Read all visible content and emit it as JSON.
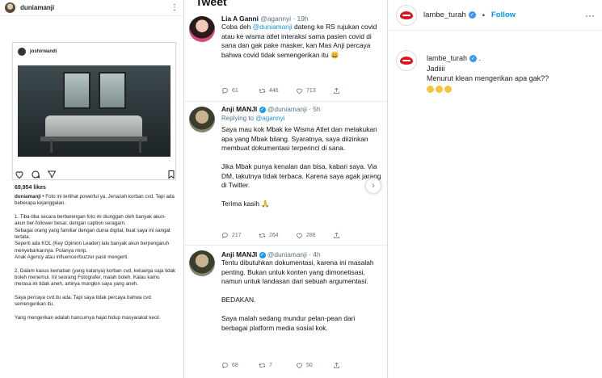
{
  "left": {
    "username": "duniamanji",
    "embedded_username": "joshirwandi",
    "likes": "69,954 likes",
    "caption_user": "duniamanji",
    "caption_paragraphs": [
      "• Foto ini terlihat powerful ya. Jenazah korban cvd. Tapi ada beberapa kejanggalan.",
      "1. Tiba-tiba secara berbarengan foto ini diunggah oleh banyak akun-akun ber-follower besar, dengan caption seragam.\nSebagai orang yang familiar dengan dunia digital, buat saya ini sangat tertata.\nSeperti ada KOL (Key Opinion Leader) lalu banyak akun berpengaruh menyebarkannya. Polanya mirip.\nAnak Agency atau influencer/buzzer pasti mengerti.",
      "2. Dalam kasus kematian (yang katanya) korban cvd, keluarga saja tidak boleh menemui. Ini seorang Fotografer, malah boleh. Kalau kamu merasa ini tidak aneh, artinya mungkin saya yang aneh.",
      "Saya percaya cvd itu ada. Tapi saya tidak percaya bahwa cvd semengerikan itu.",
      "Yang mengerikan adalah hancurnya hajat hidup masyarakat kecil."
    ]
  },
  "middle": {
    "header": "Tweet",
    "tweets": [
      {
        "name": "Lia A Ganni",
        "handle": "@agannyi · 19h",
        "text_pre": "Coba deh ",
        "mention": "@duniamanji",
        "text_post": " dateng ke RS rujukan covid atau ke wisma atlet interaksi sama pasien covid di sana dan gak pake masker, kan Mas Anji percaya bahwa covid tidak semengerikan itu 😄",
        "replies": "61",
        "retweets": "446",
        "likes": "713"
      },
      {
        "name": "Anji MANJI",
        "handle": "@duniamanji · 5h",
        "replying_label": "Replying to ",
        "replying_to": "@agannyi",
        "text": "Saya mau kok Mbak ke Wisma Atlet dan melakukan apa yang Mbak bilang. Syaratnya, saya diizinkan membuat dokumentasi terperinci di sana.\n\nJika Mbak punya kenalan dan bisa, kabari saya. Via DM, takutnya tidak terbaca. Karena saya agak jarang di Twitter.\n\nTerima kasih 🙏",
        "replies": "217",
        "retweets": "264",
        "likes": "286"
      },
      {
        "name": "Anji MANJI",
        "handle": "@duniamanji · 4h",
        "text": "Tentu dibutuhkan dokumentasi, karena ini masalah penting. Bukan untuk konten yang dimonetisasi, namun untuk landasan dari sebuah argumentasi.\n\nBEDAKAN.\n\nSaya malah sedang mundur pelan-pean dari berbagai platform media sosial kok.",
        "replies": "68",
        "retweets": "7",
        "likes": "50"
      }
    ]
  },
  "right": {
    "username": "lambe_turah",
    "follow_label": "Follow",
    "comment_user": "lambe_turah",
    "comment_line1": "Jadiiii",
    "comment_line2": "Menurut klean mengerikan apa gak??"
  },
  "colors": {
    "instagram_blue": "#0095f6",
    "twitter_blue": "#1d9bf0",
    "brand_red": "#d8161e"
  }
}
